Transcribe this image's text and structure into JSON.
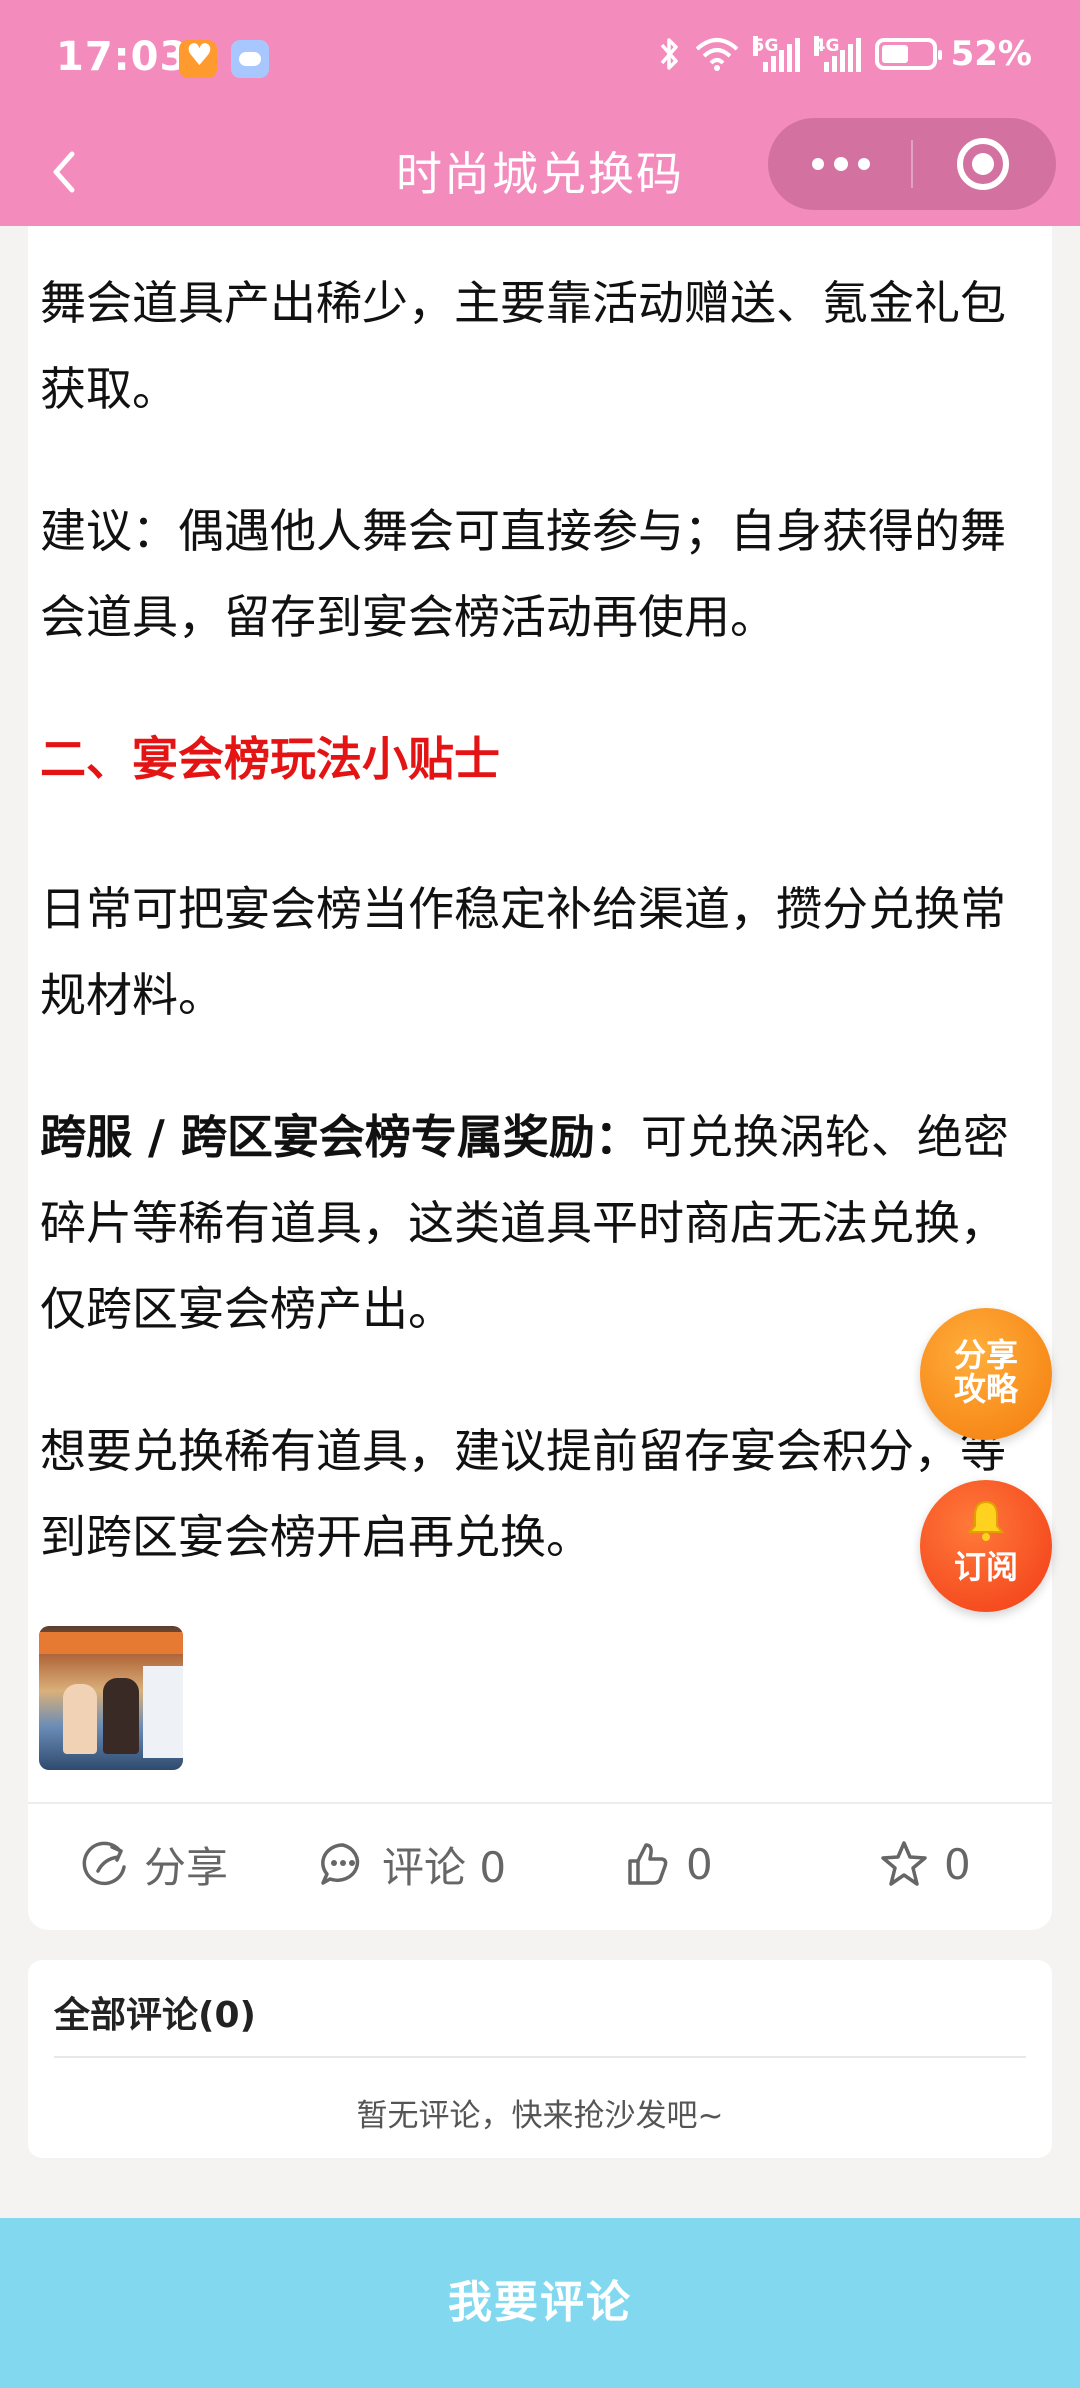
{
  "status_bar": {
    "time": "17:03",
    "network_5g": "5G",
    "network_4g": "4G",
    "battery": "52%",
    "battery_level": 0.52
  },
  "header": {
    "title": "时尚城兑换码",
    "background": "#f48bbd"
  },
  "article": {
    "para1": "舞会道具产出稀少，主要靠活动赠送、氪金礼包获取。",
    "para2": "建议：偶遇他人舞会可直接参与；自身获得的舞会道具，留存到宴会榜活动再使用。",
    "section2_title": "二、宴会榜玩法小贴士",
    "para3": "日常可把宴会榜当作稳定补给渠道，攒分兑换常规材料。",
    "para4_lead": "跨服 / 跨区宴会榜专属奖励：",
    "para4_rest": "可兑换涡轮、绝密碎片等稀有道具，这类道具平时商店无法兑换，仅跨区宴会榜产出。",
    "para5": "想要兑换稀有道具，建议提前留存宴会积分，等到跨区宴会榜开启再兑换。",
    "thumbnail_icon": "party-banquet-image"
  },
  "actions": {
    "share": "分享",
    "comment": "评论 0",
    "like": "0",
    "favorite": "0"
  },
  "floating": {
    "share_guide_line1": "分享",
    "share_guide_line2": "攻略",
    "subscribe": "订阅"
  },
  "comments": {
    "title": "全部评论(0)",
    "empty": "暂无评论，快来抢沙发吧~"
  },
  "bottom": {
    "comment_button": "我要评论",
    "background": "#82d9ef"
  }
}
